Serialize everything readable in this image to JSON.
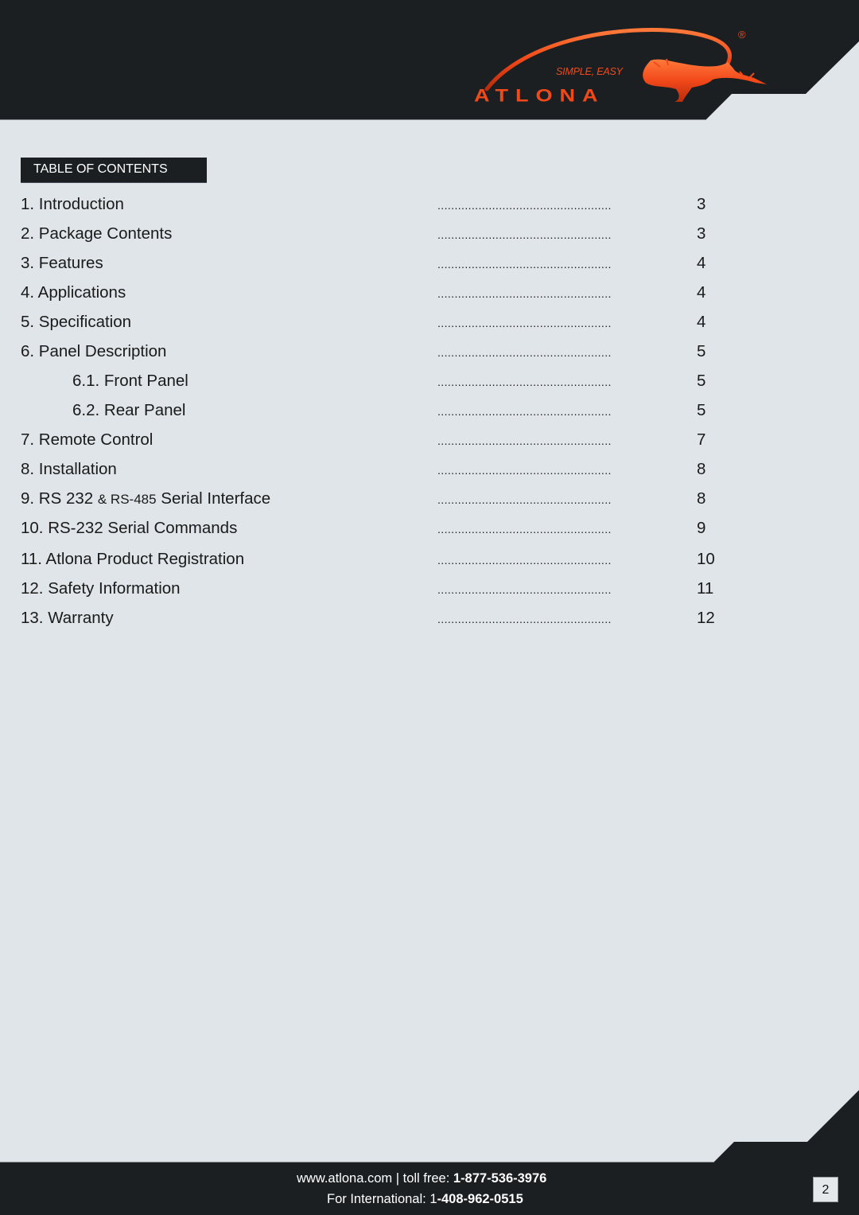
{
  "header": {
    "brand": "ATLONA",
    "tagline": "SIMPLE, EASY",
    "registered_mark": "®",
    "colors": {
      "bar": "#1b1f22",
      "brand_orange": "#f04a1a",
      "page_bg": "#dfe5e8"
    }
  },
  "toc": {
    "heading": "TABLE OF CONTENTS",
    "leader": "...................................................",
    "entries": [
      {
        "title": "1. Introduction",
        "page": "3"
      },
      {
        "title": "2. Package Contents",
        "page": "3"
      },
      {
        "title": "3. Features",
        "page": "4"
      },
      {
        "title": "4. Applications",
        "page": "4"
      },
      {
        "title": "5. Specification",
        "page": "4"
      },
      {
        "title": "6. Panel Description",
        "page": "5"
      },
      {
        "title": "6.1. Front Panel",
        "page": "5",
        "sub": true
      },
      {
        "title": "6.2. Rear Panel",
        "page": "5",
        "sub": true
      },
      {
        "title": "7. Remote Control",
        "page": "7"
      },
      {
        "title": "8. Installation",
        "page": "8"
      },
      {
        "title_parts": [
          "9. RS 232 ",
          "& RS-485",
          " Serial Interface"
        ],
        "title": "9. RS 232 & RS-485 Serial Interface",
        "page": "8"
      },
      {
        "title": "10. RS-232 Serial Commands",
        "page": "9"
      },
      {
        "title": "11. Atlona Product Registration",
        "page": "10"
      },
      {
        "title": "12. Safety Information",
        "page": "11"
      },
      {
        "title": "13. Warranty",
        "page": "12"
      }
    ]
  },
  "footer": {
    "website": "www.atlona.com",
    "separator": " | ",
    "toll_free_label": "toll free: ",
    "toll_free_number": "1-877-536-3976",
    "international_label": "For International: 1",
    "international_number": "-408-962-0515",
    "page_number": "2"
  }
}
